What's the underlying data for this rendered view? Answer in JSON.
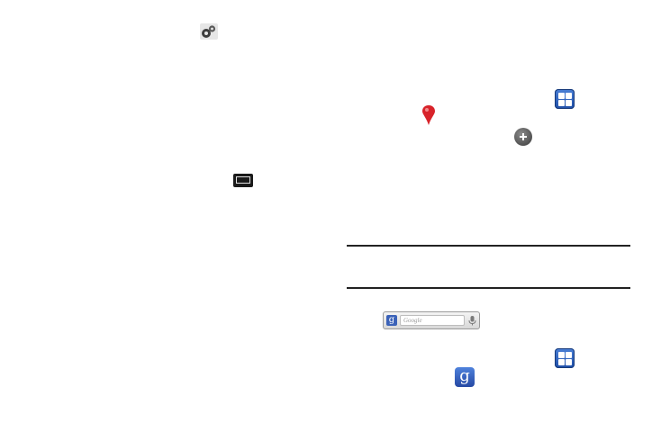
{
  "icons": {
    "settings": "gear-icon",
    "apps_top": "apps-icon",
    "map_pin": "map-pin-icon",
    "add": "plus-circle-icon",
    "menu_key": "menu-key-icon",
    "search_widget": "google-search-widget",
    "apps_bottom": "apps-icon",
    "google_app": "google-icon"
  },
  "search_widget": {
    "logo_letter": "g",
    "placeholder": "Google"
  },
  "google_app": {
    "logo_letter": "g"
  },
  "colors": {
    "apps_blue": "#2a5cbf",
    "pin_red": "#d8232a",
    "rule": "#222222"
  }
}
